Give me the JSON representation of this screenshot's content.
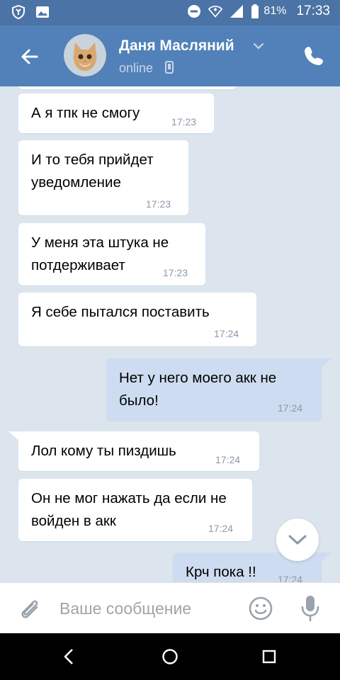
{
  "status_bar": {
    "battery": "81%",
    "time": "17:33",
    "icons": [
      "shield-icon",
      "image-icon",
      "do-not-disturb-icon",
      "wifi-icon",
      "signal-icon",
      "battery-icon"
    ]
  },
  "header": {
    "contact_name": "Даня Масляний",
    "status": "online",
    "icons": [
      "back-arrow-icon",
      "chevron-down-icon",
      "mobile-icon",
      "phone-icon"
    ]
  },
  "messages": [
    {
      "direction": "in",
      "text": "А я тпк не смогу",
      "time": "17:23"
    },
    {
      "direction": "in",
      "text": "И то тебя прийдет уведомление",
      "time": "17:23"
    },
    {
      "direction": "in",
      "text": "У меня эта штука не потдерживает",
      "time": "17:23"
    },
    {
      "direction": "in",
      "text": "Я себе пытался поставить",
      "time": "17:24"
    },
    {
      "direction": "out",
      "text": "Нет у него моего акк не было!",
      "time": "17:24"
    },
    {
      "direction": "in",
      "text": "Лол кому ты пиздишь",
      "time": "17:24"
    },
    {
      "direction": "in",
      "text": "Он не мог нажать да если не войден в акк",
      "time": "17:24"
    },
    {
      "direction": "out",
      "text": "Крч пока !!",
      "time": "17:24"
    }
  ],
  "input": {
    "placeholder": "Ваше сообщение",
    "value": ""
  },
  "colors": {
    "status_bar": "#4b73a5",
    "header": "#5181b8",
    "chat_background": "#dce5ee",
    "incoming_bubble": "#ffffff",
    "outgoing_bubble": "#cddcf0"
  }
}
